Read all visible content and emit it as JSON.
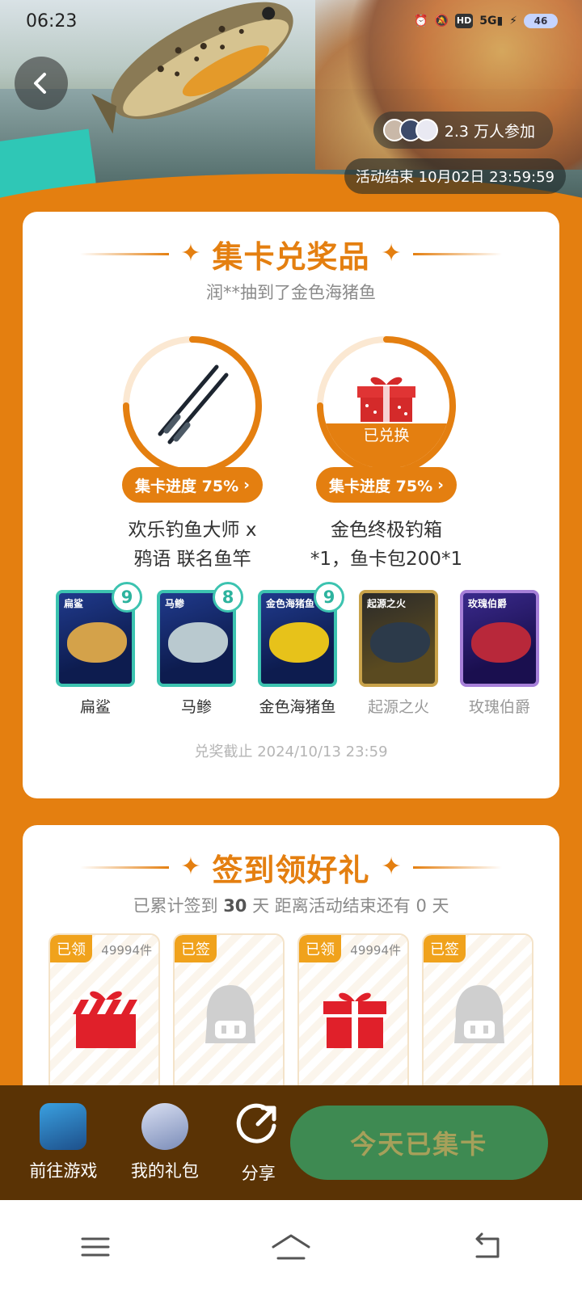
{
  "status_bar": {
    "time": "06:23",
    "battery": "46"
  },
  "hero": {
    "participants": "2.3 万人参加",
    "end_time": "活动结束 10月02日 23:59:59"
  },
  "prize_section": {
    "title": "集卡兑奖品",
    "notice": "润**抽到了金色海猪鱼",
    "prizes": [
      {
        "name_line1": "欢乐钓鱼大师 x",
        "name_line2": "鸦语 联名鱼竿",
        "progress": "集卡进度 75%",
        "progress_value": 0.75,
        "redeemed": ""
      },
      {
        "name_line1": "金色终极钓箱",
        "name_line2": "*1，鱼卡包200*1",
        "progress": "集卡进度 75%",
        "progress_value": 0.75,
        "redeemed": "已兑换"
      }
    ],
    "cards": [
      {
        "name": "扁鲨",
        "title": "扁鲨",
        "count": "9",
        "owned": true
      },
      {
        "name": "马鲹",
        "title": "马鲹",
        "count": "8",
        "owned": true
      },
      {
        "name": "金色海猪鱼",
        "title": "金色海猪鱼",
        "count": "9",
        "owned": true
      },
      {
        "name": "起源之火",
        "title": "起源之火",
        "count": "",
        "owned": false
      },
      {
        "name": "玫瑰伯爵",
        "title": "玫瑰伯爵",
        "count": "",
        "owned": false
      }
    ],
    "deadline": "兑奖截止 2024/10/13 23:59"
  },
  "signin_section": {
    "title": "签到领好礼",
    "summary_prefix": "已累计签到",
    "days": "30",
    "summary_suffix": "天  距离活动结束还有 0 天",
    "gifts": [
      {
        "tag": "已领",
        "count": "49994件",
        "type": "gift-striped"
      },
      {
        "tag": "已签",
        "count": "",
        "type": "mascot"
      },
      {
        "tag": "已领",
        "count": "49994件",
        "type": "gift"
      },
      {
        "tag": "已签",
        "count": "",
        "type": "mascot"
      }
    ]
  },
  "action_bar": {
    "go_game": "前往游戏",
    "my_gifts": "我的礼包",
    "share": "分享",
    "main_button": "今天已集卡"
  },
  "colors": {
    "accent": "#e47f10",
    "teal": "#3cc3b0",
    "button_green": "#3e8a52",
    "bar_brown": "#5a3305"
  }
}
